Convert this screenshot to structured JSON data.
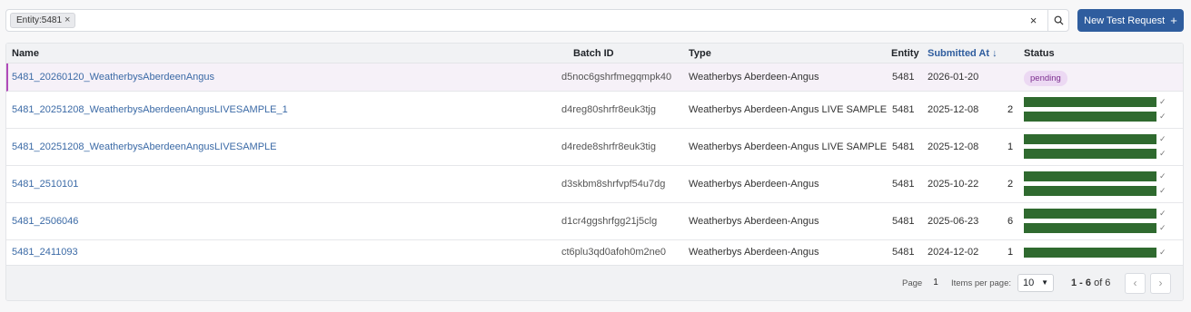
{
  "filter": {
    "chip_label": "Entity:5481",
    "chip_remove": "×",
    "clear_label": "×"
  },
  "new_request": {
    "label": "New Test Request",
    "icon": "+"
  },
  "columns": {
    "name": "Name",
    "batch_id": "Batch ID",
    "type": "Type",
    "entity": "Entity",
    "submitted_at": "Submitted At",
    "sort_icon": "↓",
    "status": "Status"
  },
  "rows": [
    {
      "name": "5481_20260120_WeatherbysAberdeenAngus",
      "batch_id": "d5noc6gshrfmegqmpk40",
      "type": "Weatherbys Aberdeen-Angus",
      "entity": "5481",
      "submitted_at": "2026-01-20",
      "count": "",
      "badge": "pending",
      "bars": 0
    },
    {
      "name": "5481_20251208_WeatherbysAberdeenAngusLIVESAMPLE_1",
      "batch_id": "d4reg80shrfr8euk3tjg",
      "type": "Weatherbys Aberdeen-Angus LIVE SAMPLE",
      "entity": "5481",
      "submitted_at": "2025-12-08",
      "count": "2",
      "badge": "",
      "bars": 2
    },
    {
      "name": "5481_20251208_WeatherbysAberdeenAngusLIVESAMPLE",
      "batch_id": "d4rede8shrfr8euk3tig",
      "type": "Weatherbys Aberdeen-Angus LIVE SAMPLE",
      "entity": "5481",
      "submitted_at": "2025-12-08",
      "count": "1",
      "badge": "",
      "bars": 2
    },
    {
      "name": "5481_2510101",
      "batch_id": "d3skbm8shrfvpf54u7dg",
      "type": "Weatherbys Aberdeen-Angus",
      "entity": "5481",
      "submitted_at": "2025-10-22",
      "count": "2",
      "badge": "",
      "bars": 2
    },
    {
      "name": "5481_2506046",
      "batch_id": "d1cr4ggshrfgg21j5clg",
      "type": "Weatherbys Aberdeen-Angus",
      "entity": "5481",
      "submitted_at": "2025-06-23",
      "count": "6",
      "badge": "",
      "bars": 2
    },
    {
      "name": "5481_2411093",
      "batch_id": "ct6plu3qd0afoh0m2ne0",
      "type": "Weatherbys Aberdeen-Angus",
      "entity": "5481",
      "submitted_at": "2024-12-02",
      "count": "1",
      "badge": "",
      "bars": 1
    }
  ],
  "check_glyph": "✓",
  "pagination": {
    "page_label": "Page",
    "page_value": "1",
    "ipp_label": "Items per page:",
    "ipp_value": "10",
    "range_bold": "1 - 6",
    "range_of": "of 6",
    "prev": "‹",
    "next": "›"
  },
  "colors": {
    "accent": "#2f5d9e",
    "bar": "#2f6a2f",
    "badge_bg": "#ecd9f3",
    "badge_fg": "#7d2f8f",
    "selected_border": "#b04ab9"
  }
}
